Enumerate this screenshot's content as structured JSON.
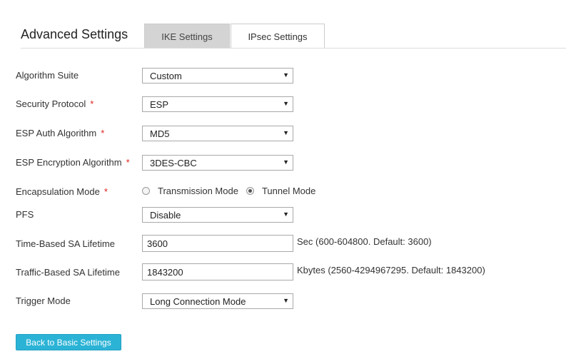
{
  "header": {
    "title": "Advanced Settings",
    "tabs": [
      {
        "label": "IKE Settings",
        "active": false
      },
      {
        "label": "IPsec Settings",
        "active": true
      }
    ]
  },
  "form": {
    "required_mark": "*",
    "algorithm_suite": {
      "label": "Algorithm Suite",
      "value": "Custom"
    },
    "security_protocol": {
      "label": "Security Protocol",
      "value": "ESP",
      "required": true
    },
    "esp_auth": {
      "label": "ESP Auth Algorithm",
      "value": "MD5",
      "required": true
    },
    "esp_encryption": {
      "label": "ESP Encryption Algorithm",
      "value": "3DES-CBC",
      "required": true
    },
    "encapsulation": {
      "label": "Encapsulation Mode",
      "required": true,
      "options": [
        {
          "label": "Transmission Mode",
          "checked": false
        },
        {
          "label": "Tunnel Mode",
          "checked": true
        }
      ]
    },
    "pfs": {
      "label": "PFS",
      "value": "Disable"
    },
    "time_lifetime": {
      "label": "Time-Based SA Lifetime",
      "value": "3600",
      "hint": "Sec (600-604800. Default: 3600)"
    },
    "traffic_lifetime": {
      "label": "Traffic-Based SA Lifetime",
      "value": "1843200",
      "hint": "Kbytes (2560-4294967295. Default: 1843200)"
    },
    "trigger_mode": {
      "label": "Trigger Mode",
      "value": "Long Connection Mode"
    }
  },
  "footer": {
    "back_label": "Back to Basic Settings"
  },
  "colors": {
    "accent": "#2bb3d6",
    "required": "#e02020",
    "inactive_tab": "#d4d4d4"
  },
  "icons": {
    "dropdown": "chevron-down-icon",
    "radio": "radio-icon"
  }
}
